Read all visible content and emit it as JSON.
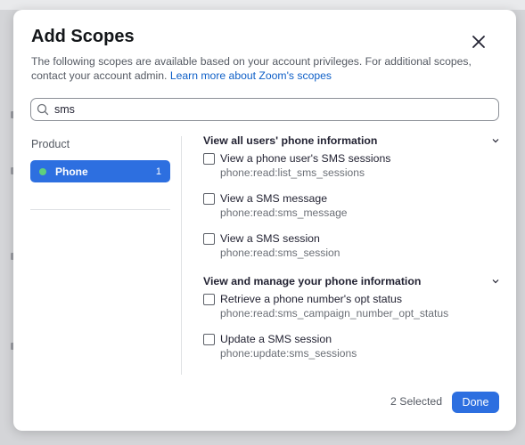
{
  "modal": {
    "title": "Add Scopes",
    "description": "The following scopes are available based on your account privileges. For additional scopes, contact your account admin.",
    "learn_more_link": "Learn more about Zoom's scopes"
  },
  "search": {
    "value": "sms",
    "icon": "search-icon"
  },
  "products": {
    "label": "Product",
    "items": [
      {
        "name": "Phone",
        "count": "1",
        "status_color": "#5fd07d"
      }
    ]
  },
  "scope_groups": [
    {
      "title": "View all users' phone information",
      "scopes": [
        {
          "name": "View a phone user's SMS sessions",
          "code": "phone:read:list_sms_sessions",
          "checked": false
        },
        {
          "name": "View a SMS message",
          "code": "phone:read:sms_message",
          "checked": false
        },
        {
          "name": "View a SMS session",
          "code": "phone:read:sms_session",
          "checked": false
        }
      ]
    },
    {
      "title": "View and manage your phone information",
      "scopes": [
        {
          "name": "Retrieve a phone number's opt status",
          "code": "phone:read:sms_campaign_number_opt_status",
          "checked": false
        },
        {
          "name": "Update a SMS session",
          "code": "phone:update:sms_sessions",
          "checked": false
        }
      ]
    }
  ],
  "footer": {
    "selected_text": "2 Selected",
    "done_label": "Done"
  },
  "colors": {
    "accent": "#2d6fe0",
    "link": "#0e5fc7",
    "status_green": "#5fd07d"
  }
}
